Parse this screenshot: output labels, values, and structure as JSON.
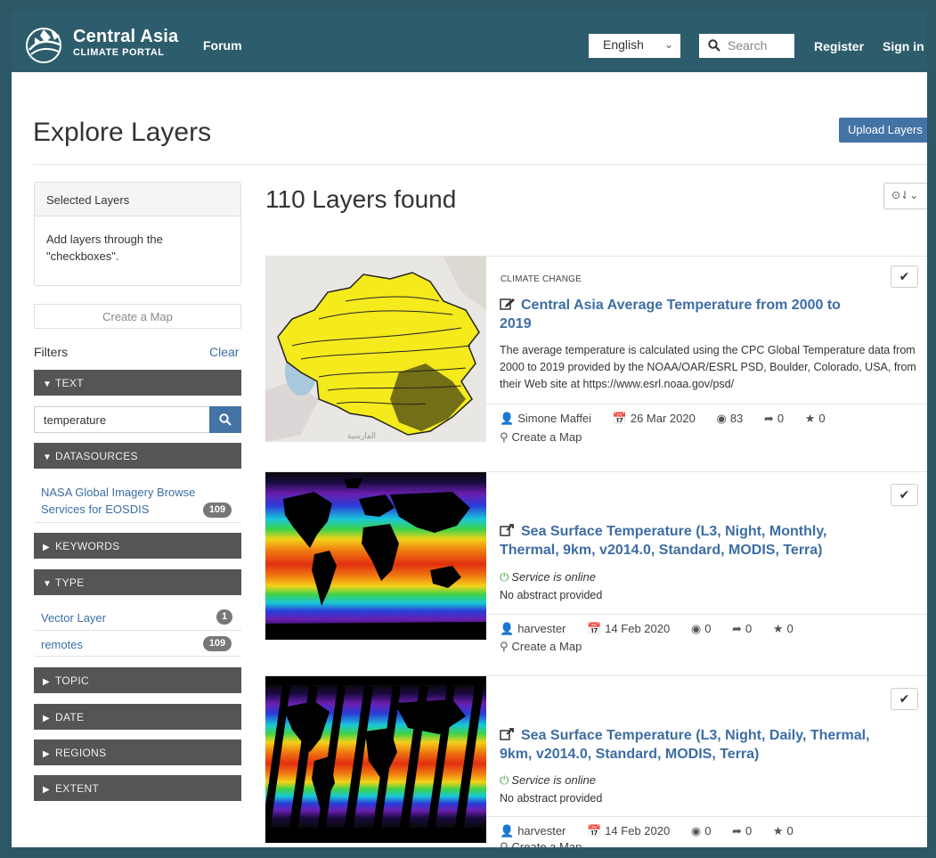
{
  "nav": {
    "brand_line1": "Central Asia",
    "brand_line2": "CLIMATE PORTAL",
    "forum": "Forum",
    "language": "English",
    "search_placeholder": "Search",
    "register": "Register",
    "sign_in": "Sign in"
  },
  "page": {
    "title": "Explore Layers",
    "upload_button": "Upload Layers"
  },
  "sidebar": {
    "selected_header": "Selected Layers",
    "selected_body": "Add layers through the \"checkboxes\".",
    "create_map": "Create a Map",
    "filters_label": "Filters",
    "clear_label": "Clear",
    "text_section": "TEXT",
    "text_value": "temperature",
    "datasources_section": "DATASOURCES",
    "datasource_item": "NASA Global Imagery Browse Services for EOSDIS",
    "datasource_count": "109",
    "keywords_section": "KEYWORDS",
    "type_section": "TYPE",
    "type_items": [
      {
        "label": "Vector Layer",
        "count": "1"
      },
      {
        "label": "remotes",
        "count": "109"
      }
    ],
    "topic_section": "TOPIC",
    "date_section": "DATE",
    "regions_section": "REGIONS",
    "extent_section": "EXTENT"
  },
  "results": {
    "count_text": "110 Layers found",
    "sort_glyph": "⊙⇃⌄",
    "cards": [
      {
        "category": "CLIMATE CHANGE",
        "title": "Central Asia Average Temperature from 2000 to 2019",
        "abstract": "The average temperature is calculated using the CPC Global Temperature data from 2000 to 2019 provided by the NOAA/OAR/ESRL PSD, Boulder, Colorado, USA, from their Web site at https://www.esrl.noaa.gov/psd/",
        "author": "Simone Maffei",
        "date": "26 Mar 2020",
        "views": "83",
        "shares": "0",
        "stars": "0",
        "create_map": "Create a Map",
        "map_label": "الفارسية"
      },
      {
        "title": "Sea Surface Temperature (L3, Night, Monthly, Thermal, 9km, v2014.0, Standard, MODIS, Terra)",
        "status": "Service is online",
        "abstract": "No abstract provided",
        "author": "harvester",
        "date": "14 Feb 2020",
        "views": "0",
        "shares": "0",
        "stars": "0",
        "create_map": "Create a Map"
      },
      {
        "title": "Sea Surface Temperature (L3, Night, Daily, Thermal, 9km, v2014.0, Standard, MODIS, Terra)",
        "status": "Service is online",
        "abstract": "No abstract provided",
        "author": "harvester",
        "date": "14 Feb 2020",
        "views": "0",
        "shares": "0",
        "stars": "0",
        "create_map": "Create a Map"
      }
    ]
  },
  "colors": {
    "navbar": "#2d5d6c",
    "link": "#3d6da3",
    "button": "#4473a6",
    "accordion": "#555555",
    "online": "#3c9e3c"
  }
}
